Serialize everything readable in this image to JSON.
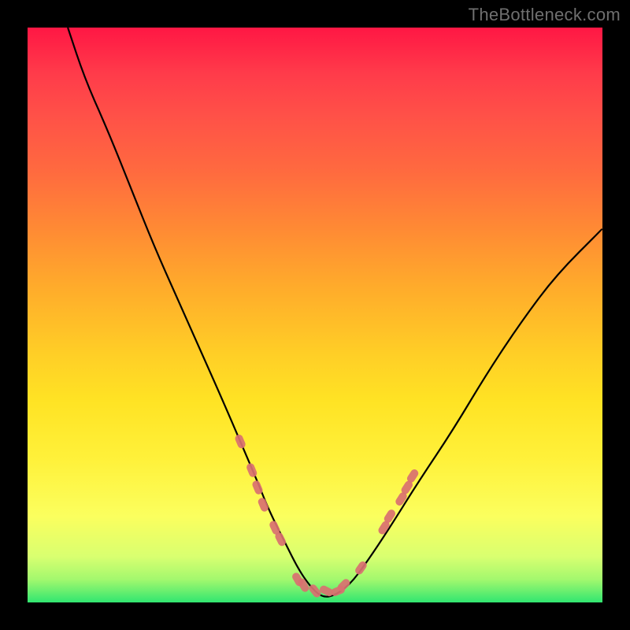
{
  "watermark": "TheBottleneck.com",
  "chart_data": {
    "type": "line",
    "title": "",
    "xlabel": "",
    "ylabel": "",
    "xlim": [
      0,
      100
    ],
    "ylim": [
      0,
      100
    ],
    "note": "No axis ticks or numeric labels are rendered in the image; x/y values below are estimated from pixel positions on a 0–100 normalized scale. Curve is a V-shape with rounded trough; markers are pink capsule-shaped dots clustered on the lower arms of the V.",
    "series": [
      {
        "name": "curve",
        "x": [
          7,
          10,
          14,
          18,
          22,
          26,
          30,
          34,
          37,
          40,
          42,
          45,
          47,
          49,
          51,
          53,
          56,
          59,
          63,
          68,
          74,
          80,
          86,
          92,
          100
        ],
        "y": [
          100,
          91,
          82,
          72,
          62,
          53,
          44,
          35,
          28,
          21,
          16,
          10,
          6,
          3,
          1,
          1,
          3,
          7,
          13,
          21,
          30,
          40,
          49,
          57,
          65
        ]
      }
    ],
    "markers": {
      "name": "dots",
      "color": "#d97070",
      "points": [
        {
          "x": 37,
          "y": 28
        },
        {
          "x": 39,
          "y": 23
        },
        {
          "x": 40,
          "y": 20
        },
        {
          "x": 41,
          "y": 17
        },
        {
          "x": 43,
          "y": 13
        },
        {
          "x": 44,
          "y": 11
        },
        {
          "x": 47,
          "y": 4
        },
        {
          "x": 48,
          "y": 3
        },
        {
          "x": 50,
          "y": 2
        },
        {
          "x": 52,
          "y": 2
        },
        {
          "x": 54,
          "y": 2
        },
        {
          "x": 55,
          "y": 3
        },
        {
          "x": 58,
          "y": 6
        },
        {
          "x": 62,
          "y": 13
        },
        {
          "x": 63,
          "y": 15
        },
        {
          "x": 65,
          "y": 18
        },
        {
          "x": 66,
          "y": 20
        },
        {
          "x": 67,
          "y": 22
        }
      ]
    },
    "background_gradient": {
      "top": "#ff1744",
      "upper_mid": "#ffab2b",
      "lower_mid": "#fff13a",
      "bottom": "#31e670"
    }
  }
}
